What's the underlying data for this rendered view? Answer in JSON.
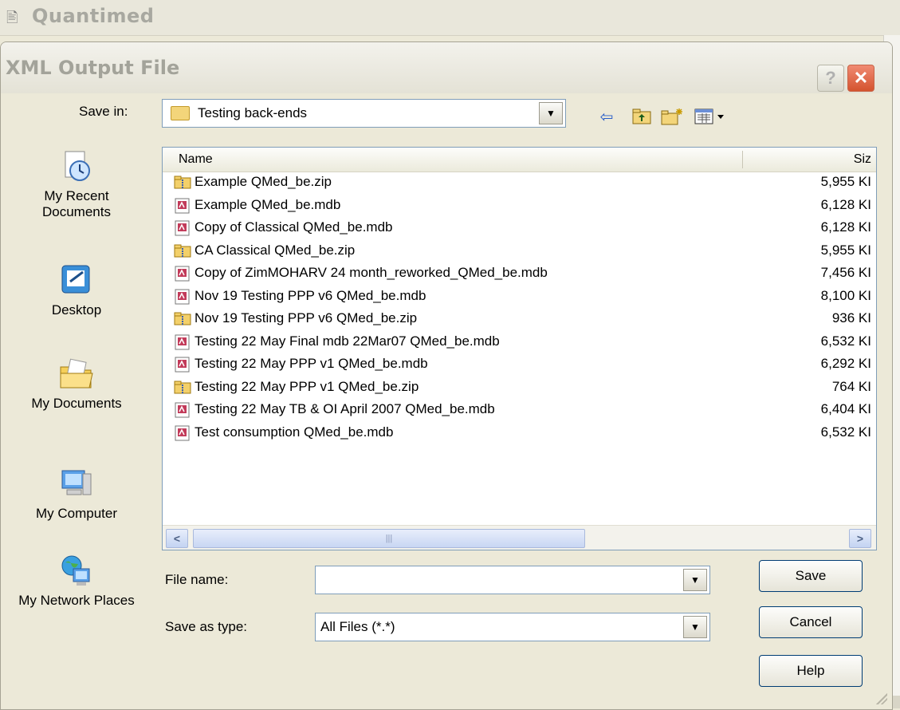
{
  "app": {
    "title": "Quantimed"
  },
  "dialog": {
    "title": "XML Output File",
    "help_glyph": "?",
    "close_glyph": "✕"
  },
  "save_in": {
    "label": "Save in:",
    "value": "Testing back-ends"
  },
  "places": [
    {
      "label": "My Recent Documents",
      "icon": "recent-documents-icon"
    },
    {
      "label": "Desktop",
      "icon": "desktop-icon"
    },
    {
      "label": "My Documents",
      "icon": "my-documents-icon"
    },
    {
      "label": "My Computer",
      "icon": "my-computer-icon"
    },
    {
      "label": "My Network Places",
      "icon": "network-places-icon"
    }
  ],
  "file_list": {
    "columns": {
      "name": "Name",
      "size": "Siz"
    },
    "rows": [
      {
        "name": "Example QMed_be.zip",
        "size": "5,955 KI",
        "type": "zip"
      },
      {
        "name": "Example QMed_be.mdb",
        "size": "6,128 KI",
        "type": "mdb"
      },
      {
        "name": "Copy of Classical QMed_be.mdb",
        "size": "6,128 KI",
        "type": "mdb"
      },
      {
        "name": "CA Classical QMed_be.zip",
        "size": "5,955 KI",
        "type": "zip"
      },
      {
        "name": "Copy of ZimMOHARV 24 month_reworked_QMed_be.mdb",
        "size": "7,456 KI",
        "type": "mdb"
      },
      {
        "name": "Nov 19 Testing PPP v6 QMed_be.mdb",
        "size": "8,100 KI",
        "type": "mdb"
      },
      {
        "name": "Nov 19 Testing PPP v6 QMed_be.zip",
        "size": "936 KI",
        "type": "zip"
      },
      {
        "name": "Testing 22 May Final mdb 22Mar07  QMed_be.mdb",
        "size": "6,532 KI",
        "type": "mdb"
      },
      {
        "name": "Testing 22 May PPP v1 QMed_be.mdb",
        "size": "6,292 KI",
        "type": "mdb"
      },
      {
        "name": "Testing 22 May PPP v1 QMed_be.zip",
        "size": "764 KI",
        "type": "zip"
      },
      {
        "name": "Testing 22 May TB & OI April 2007 QMed_be.mdb",
        "size": "6,404 KI",
        "type": "mdb"
      },
      {
        "name": "Test consumption QMed_be.mdb",
        "size": "6,532 KI",
        "type": "mdb"
      }
    ]
  },
  "file_name": {
    "label": "File name:",
    "value": ""
  },
  "save_as_type": {
    "label": "Save as type:",
    "value": "All Files (*.*)"
  },
  "buttons": {
    "save": "Save",
    "cancel": "Cancel",
    "help": "Help"
  }
}
